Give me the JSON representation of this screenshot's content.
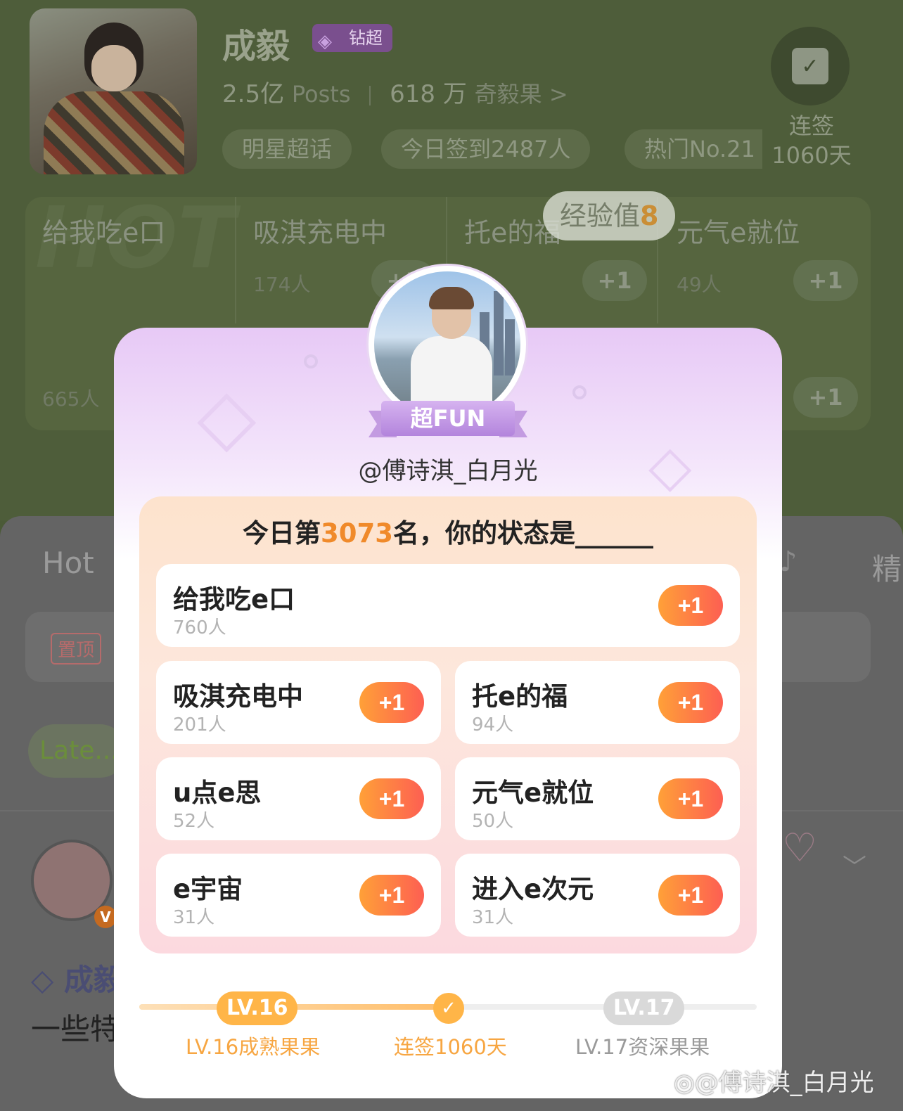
{
  "header": {
    "name": "成毅",
    "badge": "钻超",
    "posts_count": "2.5亿",
    "posts_label": "Posts",
    "fans_count": "618 万",
    "fans_label": "奇毅果 >",
    "tags": [
      "明星超话",
      "今日签到2487人",
      "热门No.21"
    ],
    "checkin_label": "连签",
    "checkin_days": "1060天"
  },
  "background_tasks": [
    {
      "label": "给我吃e口",
      "count": "665人"
    },
    {
      "label": "吸淇充电中",
      "count": "174人"
    },
    {
      "label": "托e的福",
      "count": ""
    },
    {
      "label": "元气e就位",
      "count": "49人"
    }
  ],
  "plus_label": "+1",
  "exp_tip": {
    "text": "经验值",
    "value": "8"
  },
  "lower": {
    "tab_hot": "Hot",
    "tab_jing": "精",
    "pinned": "置顶",
    "latest": "Late...",
    "post_title": "成毅",
    "post_body": "一些特"
  },
  "popup": {
    "ribbon": "超FUN",
    "username": "@傅诗淇_白月光",
    "title_prefix": "今日第",
    "rank": "3073",
    "title_suffix": "名，你的状态是______",
    "options": [
      {
        "label": "给我吃e口",
        "count": "760人"
      },
      {
        "label": "吸淇充电中",
        "count": "201人"
      },
      {
        "label": "托e的福",
        "count": "94人"
      },
      {
        "label": "u点e思",
        "count": "52人"
      },
      {
        "label": "元气e就位",
        "count": "50人"
      },
      {
        "label": "e宇宙",
        "count": "31人"
      },
      {
        "label": "进入e次元",
        "count": "31人"
      }
    ],
    "progress_fraction": 0.5,
    "level_current": "LV.16",
    "level_next": "LV.17",
    "caption_current": "LV.16成熟果果",
    "caption_middle": "连签1060天",
    "caption_next": "LV.17资深果果"
  },
  "watermark": "@傅诗淇_白月光",
  "colors": {
    "accent_orange": "#f08a2a",
    "plus_gradient_start": "#ffa038",
    "plus_gradient_end": "#fd5f52",
    "ribbon_purple": "#b384dc"
  },
  "icons": [
    "calendar-check-icon",
    "diamond-icon",
    "chevron-right-icon",
    "check-icon",
    "weibo-logo-icon"
  ]
}
